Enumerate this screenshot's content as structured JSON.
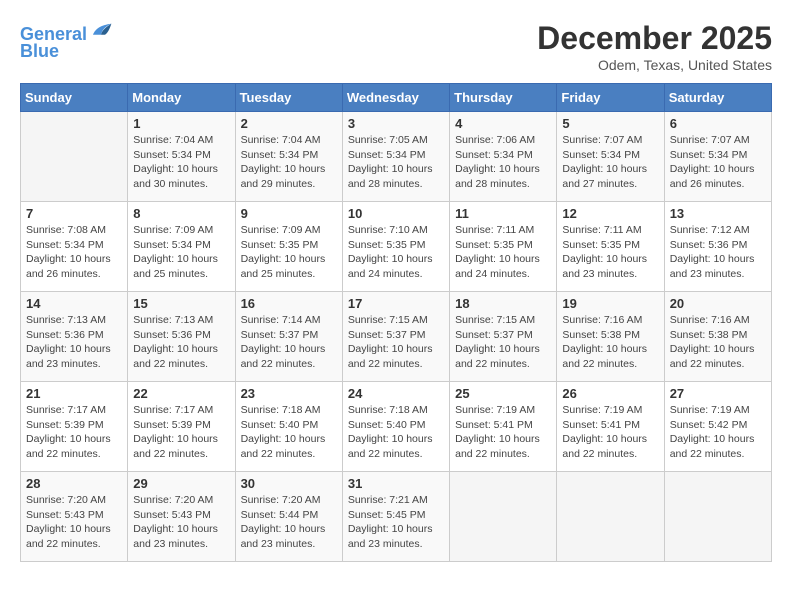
{
  "header": {
    "logo_line1": "General",
    "logo_line2": "Blue",
    "month": "December 2025",
    "location": "Odem, Texas, United States"
  },
  "weekdays": [
    "Sunday",
    "Monday",
    "Tuesday",
    "Wednesday",
    "Thursday",
    "Friday",
    "Saturday"
  ],
  "weeks": [
    [
      {
        "day": "",
        "info": ""
      },
      {
        "day": "1",
        "info": "Sunrise: 7:04 AM\nSunset: 5:34 PM\nDaylight: 10 hours\nand 30 minutes."
      },
      {
        "day": "2",
        "info": "Sunrise: 7:04 AM\nSunset: 5:34 PM\nDaylight: 10 hours\nand 29 minutes."
      },
      {
        "day": "3",
        "info": "Sunrise: 7:05 AM\nSunset: 5:34 PM\nDaylight: 10 hours\nand 28 minutes."
      },
      {
        "day": "4",
        "info": "Sunrise: 7:06 AM\nSunset: 5:34 PM\nDaylight: 10 hours\nand 28 minutes."
      },
      {
        "day": "5",
        "info": "Sunrise: 7:07 AM\nSunset: 5:34 PM\nDaylight: 10 hours\nand 27 minutes."
      },
      {
        "day": "6",
        "info": "Sunrise: 7:07 AM\nSunset: 5:34 PM\nDaylight: 10 hours\nand 26 minutes."
      }
    ],
    [
      {
        "day": "7",
        "info": "Sunrise: 7:08 AM\nSunset: 5:34 PM\nDaylight: 10 hours\nand 26 minutes."
      },
      {
        "day": "8",
        "info": "Sunrise: 7:09 AM\nSunset: 5:34 PM\nDaylight: 10 hours\nand 25 minutes."
      },
      {
        "day": "9",
        "info": "Sunrise: 7:09 AM\nSunset: 5:35 PM\nDaylight: 10 hours\nand 25 minutes."
      },
      {
        "day": "10",
        "info": "Sunrise: 7:10 AM\nSunset: 5:35 PM\nDaylight: 10 hours\nand 24 minutes."
      },
      {
        "day": "11",
        "info": "Sunrise: 7:11 AM\nSunset: 5:35 PM\nDaylight: 10 hours\nand 24 minutes."
      },
      {
        "day": "12",
        "info": "Sunrise: 7:11 AM\nSunset: 5:35 PM\nDaylight: 10 hours\nand 23 minutes."
      },
      {
        "day": "13",
        "info": "Sunrise: 7:12 AM\nSunset: 5:36 PM\nDaylight: 10 hours\nand 23 minutes."
      }
    ],
    [
      {
        "day": "14",
        "info": "Sunrise: 7:13 AM\nSunset: 5:36 PM\nDaylight: 10 hours\nand 23 minutes."
      },
      {
        "day": "15",
        "info": "Sunrise: 7:13 AM\nSunset: 5:36 PM\nDaylight: 10 hours\nand 22 minutes."
      },
      {
        "day": "16",
        "info": "Sunrise: 7:14 AM\nSunset: 5:37 PM\nDaylight: 10 hours\nand 22 minutes."
      },
      {
        "day": "17",
        "info": "Sunrise: 7:15 AM\nSunset: 5:37 PM\nDaylight: 10 hours\nand 22 minutes."
      },
      {
        "day": "18",
        "info": "Sunrise: 7:15 AM\nSunset: 5:37 PM\nDaylight: 10 hours\nand 22 minutes."
      },
      {
        "day": "19",
        "info": "Sunrise: 7:16 AM\nSunset: 5:38 PM\nDaylight: 10 hours\nand 22 minutes."
      },
      {
        "day": "20",
        "info": "Sunrise: 7:16 AM\nSunset: 5:38 PM\nDaylight: 10 hours\nand 22 minutes."
      }
    ],
    [
      {
        "day": "21",
        "info": "Sunrise: 7:17 AM\nSunset: 5:39 PM\nDaylight: 10 hours\nand 22 minutes."
      },
      {
        "day": "22",
        "info": "Sunrise: 7:17 AM\nSunset: 5:39 PM\nDaylight: 10 hours\nand 22 minutes."
      },
      {
        "day": "23",
        "info": "Sunrise: 7:18 AM\nSunset: 5:40 PM\nDaylight: 10 hours\nand 22 minutes."
      },
      {
        "day": "24",
        "info": "Sunrise: 7:18 AM\nSunset: 5:40 PM\nDaylight: 10 hours\nand 22 minutes."
      },
      {
        "day": "25",
        "info": "Sunrise: 7:19 AM\nSunset: 5:41 PM\nDaylight: 10 hours\nand 22 minutes."
      },
      {
        "day": "26",
        "info": "Sunrise: 7:19 AM\nSunset: 5:41 PM\nDaylight: 10 hours\nand 22 minutes."
      },
      {
        "day": "27",
        "info": "Sunrise: 7:19 AM\nSunset: 5:42 PM\nDaylight: 10 hours\nand 22 minutes."
      }
    ],
    [
      {
        "day": "28",
        "info": "Sunrise: 7:20 AM\nSunset: 5:43 PM\nDaylight: 10 hours\nand 22 minutes."
      },
      {
        "day": "29",
        "info": "Sunrise: 7:20 AM\nSunset: 5:43 PM\nDaylight: 10 hours\nand 23 minutes."
      },
      {
        "day": "30",
        "info": "Sunrise: 7:20 AM\nSunset: 5:44 PM\nDaylight: 10 hours\nand 23 minutes."
      },
      {
        "day": "31",
        "info": "Sunrise: 7:21 AM\nSunset: 5:45 PM\nDaylight: 10 hours\nand 23 minutes."
      },
      {
        "day": "",
        "info": ""
      },
      {
        "day": "",
        "info": ""
      },
      {
        "day": "",
        "info": ""
      }
    ]
  ]
}
